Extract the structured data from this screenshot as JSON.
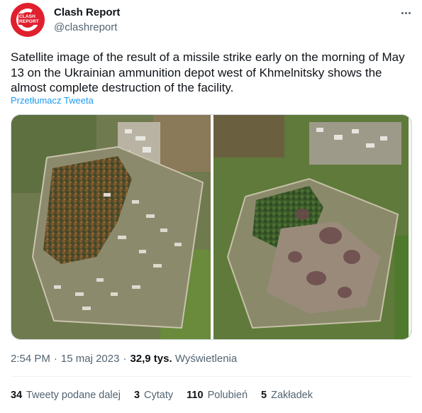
{
  "account": {
    "display_name": "Clash Report",
    "handle": "@clashreport",
    "avatar_text_line1": "CLASH",
    "avatar_text_line2": "REPORT"
  },
  "tweet": {
    "text": "Satellite image of the result of a missile strike early on the morning of May 13 on the Ukrainian ammunition depot west of Khmelnitsky shows the almost complete destruction of the facility.",
    "translate_link": "Przetłumacz Tweeta"
  },
  "media": {
    "images": [
      "satellite image before strike",
      "satellite image after strike"
    ]
  },
  "meta": {
    "time": "2:54 PM",
    "date": "15 maj 2023",
    "views_count": "32,9 tys.",
    "views_label": "Wyświetlenia"
  },
  "stats": {
    "retweets_count": "34",
    "retweets_label": "Tweety podane dalej",
    "quotes_count": "3",
    "quotes_label": "Cytaty",
    "likes_count": "110",
    "likes_label": "Polubień",
    "bookmarks_count": "5",
    "bookmarks_label": "Zakładek"
  },
  "colors": {
    "text": "#0f1419",
    "secondary": "#536471",
    "link": "#1d9bf0",
    "brand_red": "#e0202e",
    "border": "#cfd9de"
  },
  "icons": [
    "more-icon"
  ]
}
